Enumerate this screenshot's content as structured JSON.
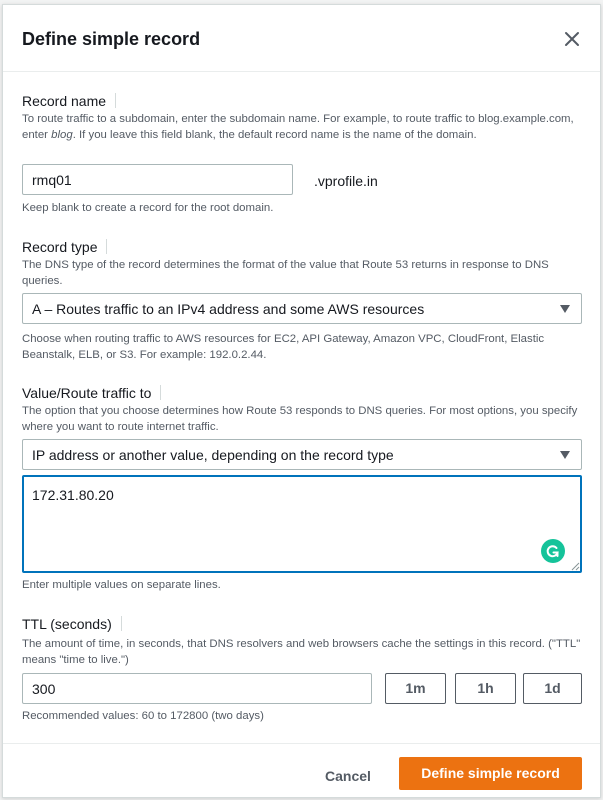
{
  "dialog": {
    "title": "Define simple record"
  },
  "record_name": {
    "label": "Record name",
    "description_pre": "To route traffic to a subdomain, enter the subdomain name. For example, to route traffic to blog.example.com, enter ",
    "description_em": "blog",
    "description_post": ". If you leave this field blank, the default record name is the name of the domain.",
    "value": "rmq01",
    "suffix": ".vprofile.in",
    "hint": "Keep blank to create a record for the root domain."
  },
  "record_type": {
    "label": "Record type",
    "description": "The DNS type of the record determines the format of the value that Route 53 returns in response to DNS queries.",
    "selected": "A – Routes traffic to an IPv4 address and some AWS resources",
    "hint": "Choose when routing traffic to AWS resources for EC2, API Gateway, Amazon VPC, CloudFront, Elastic Beanstalk, ELB, or S3. For example: 192.0.2.44."
  },
  "value_route": {
    "label": "Value/Route traffic to",
    "description": "The option that you choose determines how Route 53 responds to DNS queries. For most options, you specify where you want to route internet traffic.",
    "selected": "IP address or another value, depending on the record type",
    "value": "172.31.80.20",
    "hint": "Enter multiple values on separate lines."
  },
  "ttl": {
    "label": "TTL (seconds)",
    "description": "The amount of time, in seconds, that DNS resolvers and web browsers cache the settings in this record. (\"TTL\" means \"time to live.\")",
    "value": "300",
    "presets": [
      "1m",
      "1h",
      "1d"
    ],
    "hint": "Recommended values: 60 to 172800 (two days)"
  },
  "footer": {
    "cancel_label": "Cancel",
    "submit_label": "Define simple record"
  },
  "colors": {
    "primary": "#ec7211",
    "focus_border": "#0073bb",
    "grammarly": "#15c39a"
  }
}
